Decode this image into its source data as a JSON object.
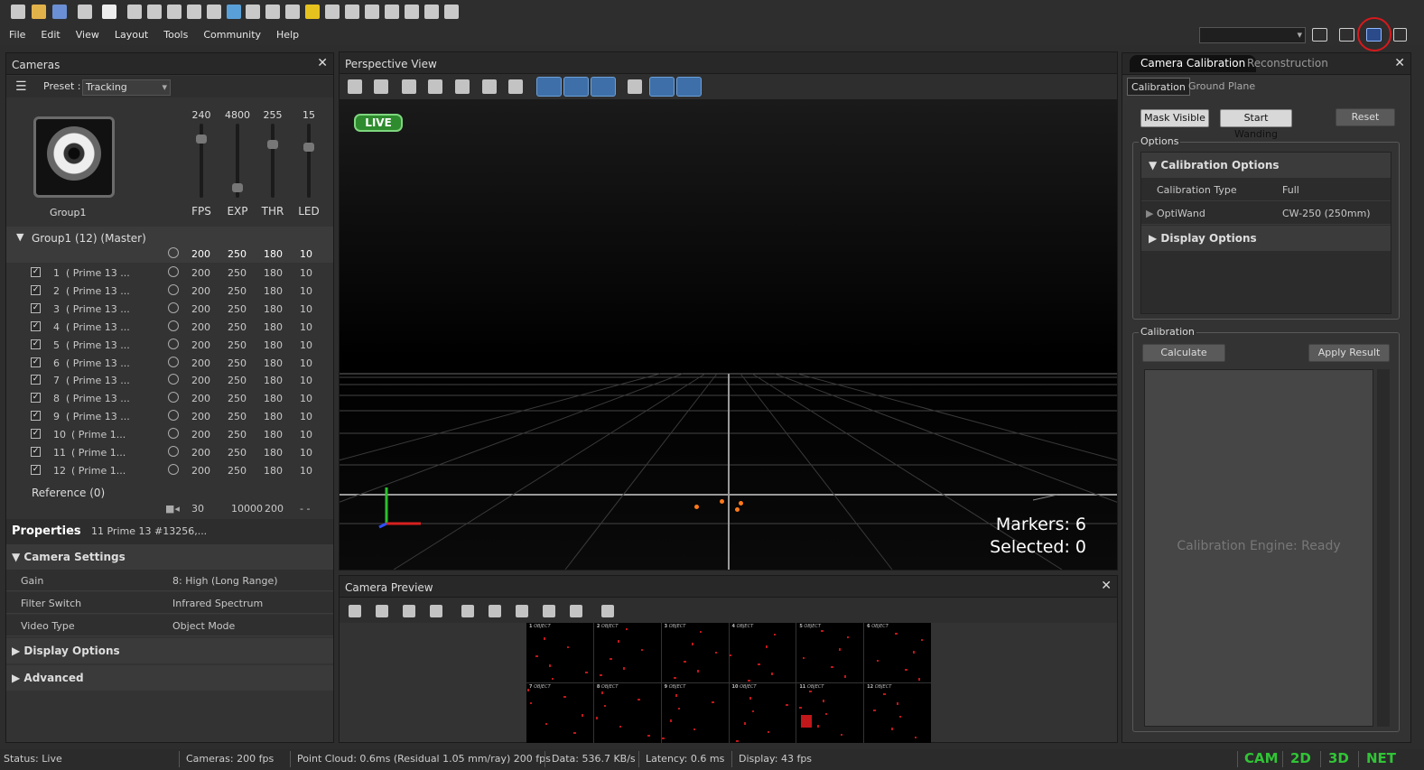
{
  "menu": [
    "File",
    "Edit",
    "View",
    "Layout",
    "Tools",
    "Community",
    "Help"
  ],
  "cameras_panel": {
    "title": "Cameras",
    "preset_label": "Preset :",
    "preset_value": "Tracking",
    "group_name": "Group1",
    "sliders": [
      {
        "label": "FPS",
        "value": "240",
        "level": 0.78
      },
      {
        "label": "EXP",
        "value": "4800",
        "level": 0.08
      },
      {
        "label": "THR",
        "value": "255",
        "level": 0.68
      },
      {
        "label": "LED",
        "value": "15",
        "level": 0.62
      }
    ],
    "group_row": {
      "label": "Group1 (12) (Master)",
      "fps": "200",
      "exp": "250",
      "thr": "180",
      "led": "10"
    },
    "cameras": [
      {
        "num": "1",
        "name": "( Prime 13 ...",
        "fps": "200",
        "exp": "250",
        "thr": "180",
        "led": "10"
      },
      {
        "num": "2",
        "name": "( Prime 13 ...",
        "fps": "200",
        "exp": "250",
        "thr": "180",
        "led": "10"
      },
      {
        "num": "3",
        "name": "( Prime 13 ...",
        "fps": "200",
        "exp": "250",
        "thr": "180",
        "led": "10"
      },
      {
        "num": "4",
        "name": "( Prime 13 ...",
        "fps": "200",
        "exp": "250",
        "thr": "180",
        "led": "10"
      },
      {
        "num": "5",
        "name": "( Prime 13 ...",
        "fps": "200",
        "exp": "250",
        "thr": "180",
        "led": "10"
      },
      {
        "num": "6",
        "name": "( Prime 13 ...",
        "fps": "200",
        "exp": "250",
        "thr": "180",
        "led": "10"
      },
      {
        "num": "7",
        "name": "( Prime 13 ...",
        "fps": "200",
        "exp": "250",
        "thr": "180",
        "led": "10"
      },
      {
        "num": "8",
        "name": "( Prime 13 ...",
        "fps": "200",
        "exp": "250",
        "thr": "180",
        "led": "10"
      },
      {
        "num": "9",
        "name": "( Prime 13 ...",
        "fps": "200",
        "exp": "250",
        "thr": "180",
        "led": "10"
      },
      {
        "num": "10",
        "name": "( Prime 1...",
        "fps": "200",
        "exp": "250",
        "thr": "180",
        "led": "10"
      },
      {
        "num": "11",
        "name": "( Prime 1...",
        "fps": "200",
        "exp": "250",
        "thr": "180",
        "led": "10"
      },
      {
        "num": "12",
        "name": "( Prime 1...",
        "fps": "200",
        "exp": "250",
        "thr": "180",
        "led": "10"
      }
    ],
    "reference": {
      "label": "Reference (0)",
      "fps": "30",
      "exp": "10000",
      "thr": "200",
      "led": "- -"
    }
  },
  "properties": {
    "title": "Properties",
    "subject": "11 Prime 13 #13256,...",
    "section_camera": "Camera Settings",
    "rows": [
      {
        "key": "Gain",
        "value": "8: High (Long Range)"
      },
      {
        "key": "Filter Switch",
        "value": "Infrared Spectrum"
      },
      {
        "key": "Video Type",
        "value": "Object Mode"
      }
    ],
    "section_display": "Display Options",
    "section_advanced": "Advanced"
  },
  "perspective": {
    "title": "Perspective View",
    "live": "LIVE",
    "markers": "Markers: 6",
    "selected": "Selected: 0"
  },
  "preview": {
    "title": "Camera Preview",
    "tiles": [
      "1",
      "2",
      "3",
      "4",
      "5",
      "6",
      "7",
      "8",
      "9",
      "10",
      "11",
      "12"
    ],
    "tile_label": "OBJECT"
  },
  "calibration": {
    "tab_active": "Camera Calibration",
    "tab_other": "Reconstruction",
    "subtab_active": "Calibration",
    "subtab_other": "Ground Plane",
    "mask_visible": "Mask Visible",
    "start_wanding": "Start Wanding",
    "reset": "Reset",
    "options_title": "Options",
    "calib_options": "Calibration Options",
    "calib_type_key": "Calibration Type",
    "calib_type_val": "Full",
    "optiwand_key": "OptiWand",
    "optiwand_val": "CW-250 (250mm)",
    "display_options": "Display Options",
    "calibration_title": "Calibration",
    "calculate": "Calculate",
    "apply_result": "Apply Result",
    "engine_status": "Calibration Engine: Ready"
  },
  "status": {
    "status": "Status: Live",
    "cameras": "Cameras: 200 fps",
    "point_cloud": "Point Cloud: 0.6ms (Residual 1.05 mm/ray) 200 fps",
    "data": "Data: 536.7 KB/s",
    "latency": "Latency: 0.6 ms",
    "display": "Display: 43 fps",
    "modes": [
      "CAM",
      "2D",
      "3D",
      "NET"
    ]
  },
  "colors": {
    "accent": "#3e6fa8",
    "live": "#2e8b2e",
    "mode": "#31c436",
    "highlight": "#d7191c",
    "marker": "#ff7a1a"
  }
}
